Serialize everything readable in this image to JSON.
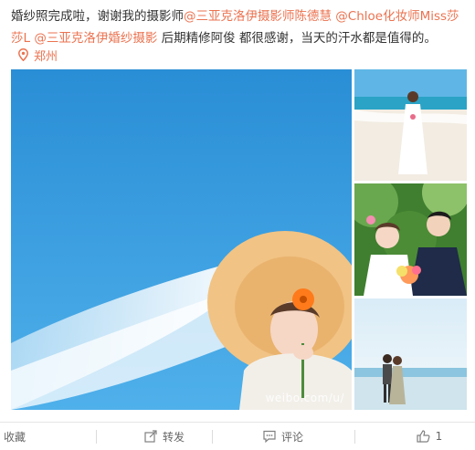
{
  "post": {
    "text_1": "婚纱照完成啦，谢谢我的摄影师",
    "mention_1": "@三亚克洛伊摄影师陈德慧",
    "text_2": " ",
    "mention_2": "@Chloe化妆师Miss莎莎L",
    "text_3": " ",
    "mention_3": "@三亚克洛伊婚纱摄影",
    "text_4": " 后期精修阿俊 都很感谢，当天的汗水都是值得的。",
    "location": "郑州"
  },
  "gallery": {
    "watermark": "weibo.com/u/"
  },
  "actions": {
    "favorite": "收藏",
    "forward": "转发",
    "comment": "评论",
    "like_count": "1"
  },
  "colors": {
    "accent": "#eb7350",
    "text": "#333333",
    "muted": "#666666",
    "sky": "#2b95d9"
  }
}
